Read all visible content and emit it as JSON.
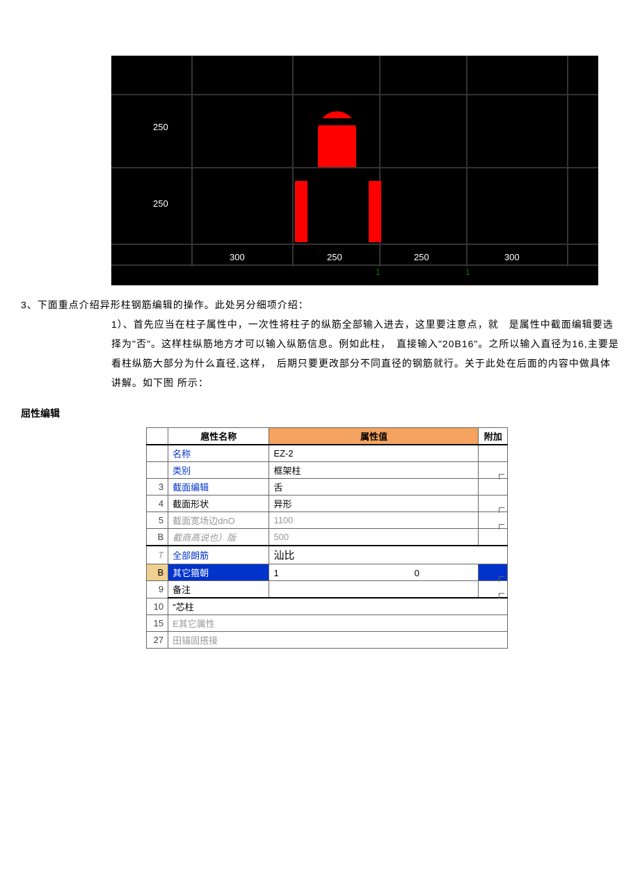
{
  "cad": {
    "left_labels": [
      "250",
      "250"
    ],
    "bottom_labels": [
      "300",
      "250",
      "250",
      "300"
    ],
    "green_labels": [
      "1",
      "1"
    ]
  },
  "body_text": {
    "line1": "3、下面重点介绍异形柱钢筋编辑的操作。此处另分细项介绍：",
    "para1": "1）、首先应当在柱子属性中，一次性将柱子的纵筋全部输入进去，这里要注意点，就　是属性中截面编辑要选择为\"否\"。这样柱纵筋地方才可以输入纵筋信息。例如此柱，　直接输入\"20B16\"。之所以输入直径为16,主要是看柱纵筋大部分为什么直径,这样，　后期只要更改部分不同直径的钢筋就行。关于此处在后面的内容中做具体讲解。如下图 所示："
  },
  "prop_editor": {
    "title": "屈性编辑",
    "headers": {
      "name": "扈性名称",
      "value": "属性值",
      "extra": "附加"
    },
    "rows": [
      {
        "num": "",
        "name": "名称",
        "name_class": "blue-text",
        "value": "EZ-2",
        "extra": ""
      },
      {
        "num": "",
        "name": "类别",
        "name_class": "blue-text",
        "value": "框架柱",
        "extra": "cb"
      },
      {
        "num": "3",
        "name": "截面编辑",
        "name_class": "blue-text",
        "value": "舌",
        "extra": ""
      },
      {
        "num": "4",
        "name": "截面形状",
        "name_class": "",
        "value": "异形",
        "extra": "cb"
      },
      {
        "num": "5",
        "name": "截面宽场边dnO",
        "name_class": "gray-text",
        "value": "1100",
        "value_class": "gray-text",
        "extra": "cb"
      },
      {
        "num": "B",
        "name": "截商高说也）版",
        "name_class": "gray-italic",
        "value": "500",
        "value_class": "gray-text",
        "extra": ""
      },
      {
        "num": "T",
        "num_class": "gray-italic",
        "name": "全部朗筋",
        "name_class": "blue-text",
        "value": "汕比",
        "extra": "cb",
        "wide_value": true
      },
      {
        "num": "B",
        "name": "其它箍朝",
        "name_class": "",
        "value": "1　　　　　　　　　　　　　　　0",
        "extra": "cb",
        "selected": true
      },
      {
        "num": "9",
        "name": "备注",
        "name_class": "",
        "value": "",
        "extra": "cb"
      },
      {
        "num": "10",
        "name": "\"芯柱",
        "name_class": "",
        "value": "",
        "extra": "",
        "span_value": true
      },
      {
        "num": "15",
        "name": "E其它属性",
        "name_class": "gray-text",
        "value": "",
        "extra": "",
        "span_value": true
      },
      {
        "num": "27",
        "name": "田锚固搭接",
        "name_class": "gray-text",
        "value": "",
        "extra": "",
        "span_value": true
      }
    ]
  }
}
